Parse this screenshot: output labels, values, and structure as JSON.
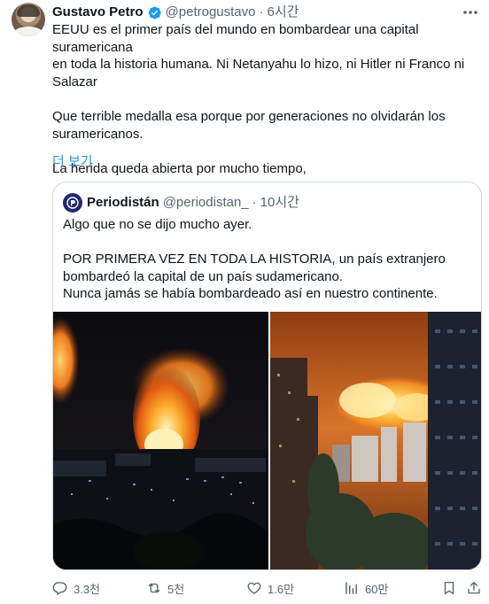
{
  "tweet": {
    "author_name": "Gustavo Petro",
    "handle": "@petrogustavo",
    "separator": "·",
    "time": "6시간",
    "text_lines": [
      "EEUU es el primer país del mundo en bombardear una capital suramericana",
      "en toda la historia humana. Ni Netanyahu lo hizo, ni Hitler ni Franco ni",
      "Salazar",
      "",
      "Que terrible medalla esa porque por generaciones no olvidarán los",
      "suramericanos.",
      "",
      "La herida queda abierta por mucho tiempo,"
    ],
    "show_more": "더 보기",
    "verified_color": "#1d9bf0",
    "more_icon": "ellipsis-icon"
  },
  "quote": {
    "author_name": "Periodistán",
    "handle": "@periodistan_",
    "separator": "·",
    "time": "10시간",
    "avatar_icon": "periodistan-logo",
    "text_lines": [
      "Algo que no se dijo mucho ayer.",
      "",
      "POR PRIMERA VEZ EN TODA LA HISTORIA, un país extranjero",
      "bombardeó la capital de un país sudamericano.",
      "Nunca jamás se había bombardeado así en nuestro continente."
    ],
    "media": [
      {
        "icon": "night-explosion-photo"
      },
      {
        "icon": "city-explosion-photo"
      }
    ]
  },
  "actions": {
    "reply": {
      "icon": "reply-icon",
      "count": "3.3천"
    },
    "retweet": {
      "icon": "retweet-icon",
      "count": "5천"
    },
    "like": {
      "icon": "heart-icon",
      "count": "1.6만"
    },
    "views": {
      "icon": "views-icon",
      "count": "60만"
    },
    "bookmark": {
      "icon": "bookmark-icon"
    },
    "share": {
      "icon": "share-icon"
    }
  },
  "colors": {
    "text": "#0f1419",
    "secondary": "#536471",
    "accent": "#1d9bf0",
    "border": "#cfd9de"
  }
}
